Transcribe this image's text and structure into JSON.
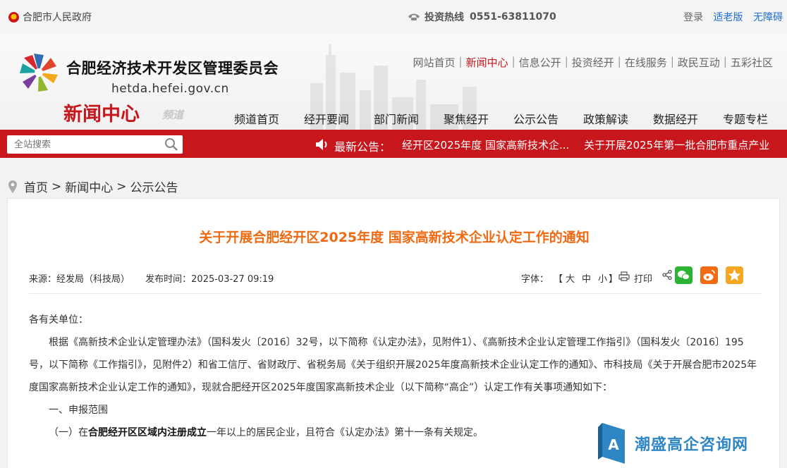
{
  "topbar": {
    "gov_name": "合肥市人民政府",
    "hotline_label": "投资热线",
    "hotline_number": "0551-63811070",
    "links": [
      "登录",
      "适老版",
      "无障碍"
    ]
  },
  "header": {
    "org_name": "合肥经济技术开发区管理委员会",
    "domain": "hetda.hefei.gov.cn",
    "channel": "新闻中心",
    "channel_sub": "频道",
    "main_nav": [
      "网站首页",
      "新闻中心",
      "信息公开",
      "投资经开",
      "在线服务",
      "政民互动",
      "五彩社区"
    ],
    "main_nav_active": "新闻中心",
    "sub_nav": [
      "频道首页",
      "经开要闻",
      "部门新闻",
      "聚焦经开",
      "公示公告",
      "政策解读",
      "数据经开",
      "专题专栏"
    ]
  },
  "search": {
    "placeholder": "全站搜索"
  },
  "notice": {
    "label": "最新公告：",
    "items": [
      "经开区2025年度 国家高新技术企...",
      "关于开展2025年第一批合肥市重点产业"
    ]
  },
  "breadcrumb": [
    "首页",
    "新闻中心",
    "公示公告"
  ],
  "article": {
    "title": "关于开展合肥经开区2025年度 国家高新技术企业认定工作的通知",
    "source": "来源：经发局（科技局）",
    "publish_time": "发布时间：2025-03-27 09:19",
    "font_label": "字体：",
    "font_sizes": [
      "【",
      "大",
      "中",
      "小",
      "】"
    ],
    "print_label": "打印",
    "salutation": "各有关单位：",
    "paragraph1": "根据《高新技术企业认定管理办法》（国科发火〔2016〕32号，以下简称《认定办法》，见附件1）、《高新技术企业认定管理工作指引》（国科发火〔2016〕195号，以下简称《工作指引》，见附件2）和省工信厅、省财政厅、省税务局《关于组织开展2025年度高新技术企业认定工作的通知》、市科技局《关于开展合肥市2025年度国家高新技术企业认定工作的通知》，现就合肥经开区2025年度国家高新技术企业（以下简称“高企”）认定工作有关事项通知如下：",
    "section1": "一、申报范围",
    "item1_pre": "（一）在",
    "item1_bold": "合肥经开区区域内注册成立",
    "item1_post": "一年以上的居民企业，且符合《认定办法》第十一条有关规定。"
  },
  "watermark": {
    "text": "潮盛高企咨询网"
  },
  "colors": {
    "brand_red": "#c8161d",
    "title_orange": "#ef6b13",
    "link_blue": "#1f6fd1"
  }
}
